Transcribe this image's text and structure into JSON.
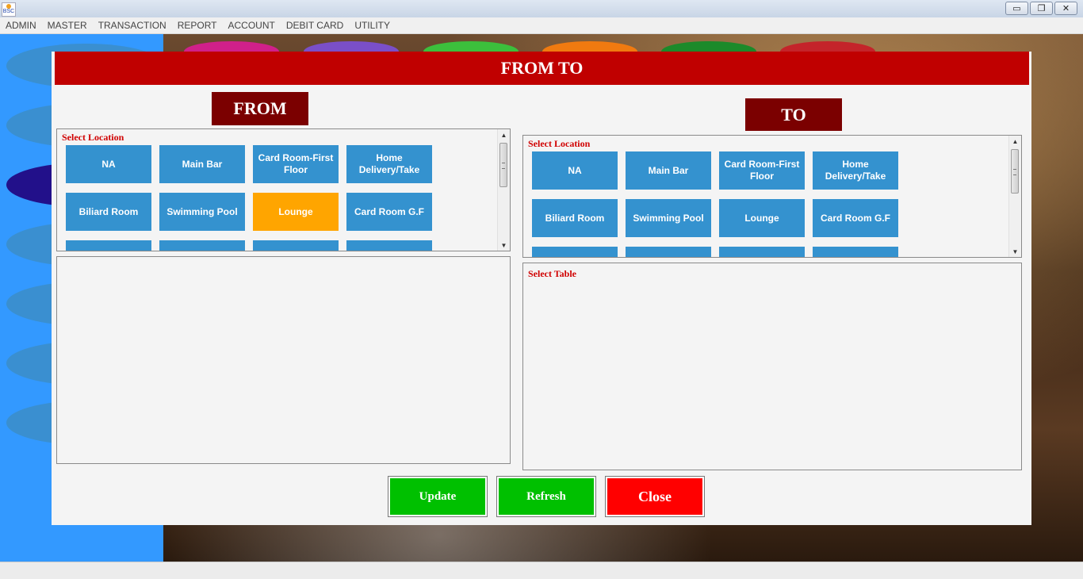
{
  "window": {
    "app_icon_text": "BSC",
    "minimize_glyph": "▭",
    "restore_glyph": "❐",
    "close_glyph": "✕"
  },
  "menu": [
    "ADMIN",
    "MASTER",
    "TRANSACTION",
    "REPORT",
    "ACCOUNT",
    "DEBIT CARD",
    "UTILITY"
  ],
  "dialog": {
    "title": "FROM TO",
    "from": {
      "label": "FROM",
      "location_title": "Select Location",
      "locations": [
        "NA",
        "Main Bar",
        "Card Room-First Floor",
        "Home Delivery/Take",
        "Biliard Room",
        "Swimming Pool",
        "Lounge",
        "Card Room G.F"
      ],
      "selected": "Lounge"
    },
    "to": {
      "label": "TO",
      "location_title": "Select Location",
      "locations": [
        "NA",
        "Main Bar",
        "Card Room-First Floor",
        "Home Delivery/Take",
        "Biliard Room",
        "Swimming Pool",
        "Lounge",
        "Card Room G.F"
      ],
      "table_title": "Select Table"
    },
    "buttons": {
      "update": "Update",
      "refresh": "Refresh",
      "close": "Close"
    },
    "colors": {
      "header": "#c00000",
      "side_label": "#7b0000",
      "location_button": "#3492cf",
      "selected_location": "#ffa500",
      "update": "#00c000",
      "refresh": "#00c000",
      "close": "#ff0000"
    }
  }
}
